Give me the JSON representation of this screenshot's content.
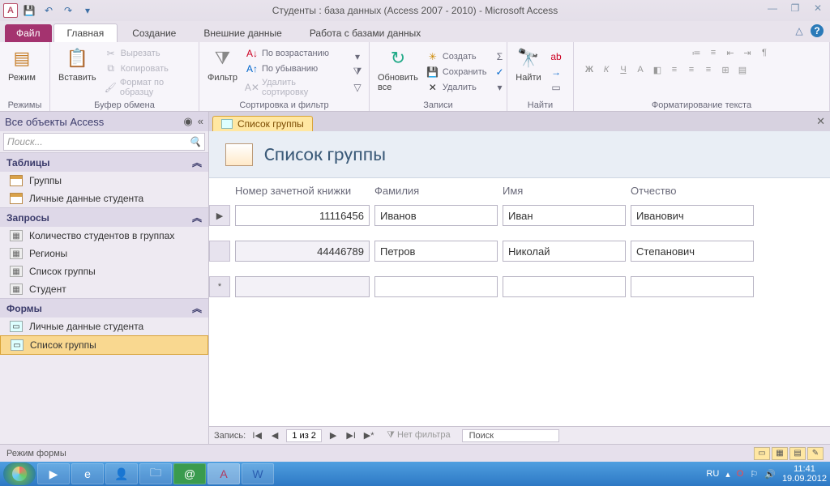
{
  "title": "Студенты : база данных (Access 2007 - 2010)  -  Microsoft Access",
  "qat": {
    "app_letter": "A"
  },
  "tabs": {
    "file": "Файл",
    "home": "Главная",
    "create": "Создание",
    "external": "Внешние данные",
    "dbtools": "Работа с базами данных"
  },
  "ribbon": {
    "views": {
      "mode": "Режим",
      "label": "Режимы"
    },
    "clipboard": {
      "paste": "Вставить",
      "cut": "Вырезать",
      "copy": "Копировать",
      "format": "Формат по образцу",
      "label": "Буфер обмена"
    },
    "sortfilter": {
      "filter": "Фильтр",
      "asc": "По возрастанию",
      "desc": "По убыванию",
      "clear": "Удалить сортировку",
      "label": "Сортировка и фильтр"
    },
    "records": {
      "refresh": "Обновить все",
      "new": "Создать",
      "save": "Сохранить",
      "delete": "Удалить",
      "label": "Записи"
    },
    "find": {
      "find": "Найти",
      "label": "Найти"
    },
    "textfmt": {
      "label": "Форматирование текста"
    }
  },
  "nav": {
    "header": "Все объекты Access",
    "search_ph": "Поиск...",
    "g_tables": "Таблицы",
    "t1": "Группы",
    "t2": "Личные данные студента",
    "g_queries": "Запросы",
    "q1": "Количество студентов в группах",
    "q2": "Регионы",
    "q3": "Список группы",
    "q4": "Студент",
    "g_forms": "Формы",
    "f1": "Личные данные студента",
    "f2": "Список группы"
  },
  "doc": {
    "tab": "Список группы",
    "title": "Список группы",
    "col1": "Номер зачетной книжки",
    "col2": "Фамилия",
    "col3": "Имя",
    "col4": "Отчество",
    "r1": {
      "num": "11116456",
      "fam": "Иванов",
      "name": "Иван",
      "pat": "Иванович"
    },
    "r2": {
      "num": "44446789",
      "fam": "Петров",
      "name": "Николай",
      "pat": "Степанович"
    }
  },
  "recnav": {
    "label": "Запись:",
    "pos": "1 из 2",
    "nofilter": "Нет фильтра",
    "search": "Поиск"
  },
  "status": {
    "mode": "Режим формы"
  },
  "tray": {
    "lang": "RU",
    "time": "11:41",
    "date": "19.09.2012"
  }
}
